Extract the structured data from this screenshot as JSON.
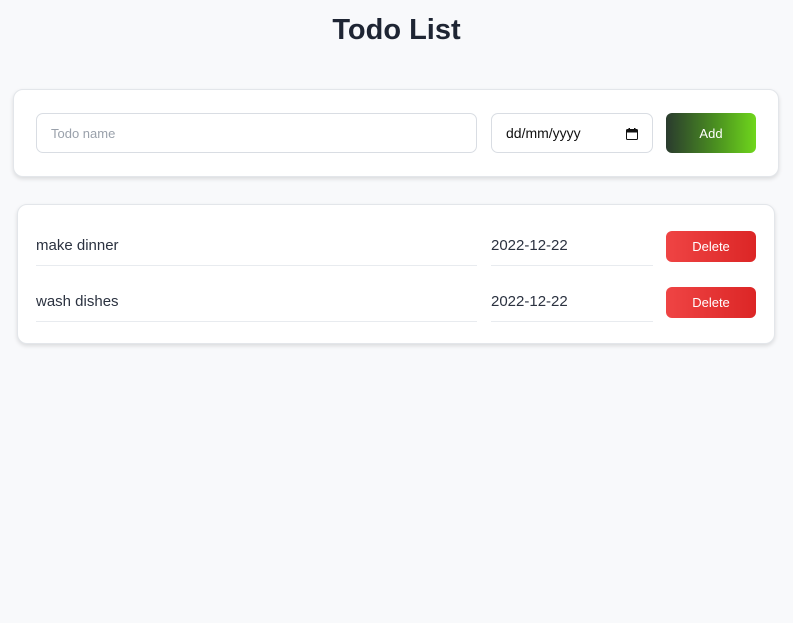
{
  "page": {
    "title": "Todo List"
  },
  "add_form": {
    "name_placeholder": "Todo name",
    "name_value": "",
    "date_placeholder": "dd/mm/yyyy",
    "add_label": "Add"
  },
  "todos": [
    {
      "name": "make dinner",
      "date": "2022-12-22",
      "delete_label": "Delete"
    },
    {
      "name": "wash dishes",
      "date": "2022-12-22",
      "delete_label": "Delete"
    }
  ],
  "icons": {
    "date_picker": "calendar-icon"
  },
  "colors": {
    "background": "#f8f9fb",
    "add_gradient_start": "#2a3b2e",
    "add_gradient_end": "#6fd61c",
    "delete": "#ef4444"
  }
}
